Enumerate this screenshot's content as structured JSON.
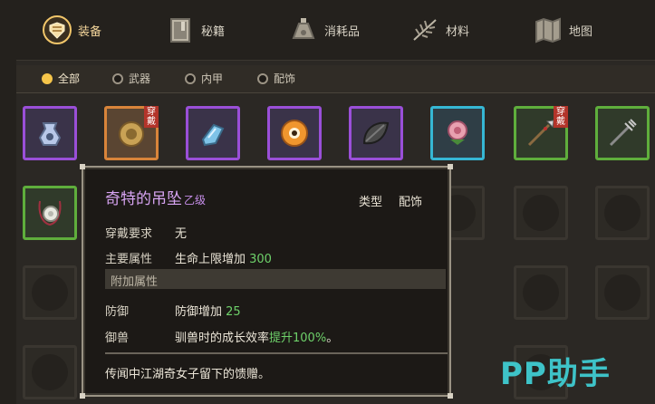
{
  "tabs": [
    {
      "label": "装备",
      "icon": "armor-icon",
      "active": true
    },
    {
      "label": "秘籍",
      "icon": "book-icon",
      "active": false
    },
    {
      "label": "消耗品",
      "icon": "potion-icon",
      "active": false
    },
    {
      "label": "材料",
      "icon": "herb-icon",
      "active": false
    },
    {
      "label": "地图",
      "icon": "map-icon",
      "active": false
    }
  ],
  "filters": [
    {
      "label": "全部",
      "selected": true
    },
    {
      "label": "武器",
      "selected": false
    },
    {
      "label": "内甲",
      "selected": false
    },
    {
      "label": "配饰",
      "selected": false
    }
  ],
  "inventory": [
    {
      "item": "pouch-icon",
      "rarity": "purple",
      "equipped": false
    },
    {
      "item": "shield-icon",
      "rarity": "orange",
      "equipped": true
    },
    {
      "item": "boots-icon",
      "rarity": "purple",
      "equipped": false
    },
    {
      "item": "eye-icon",
      "rarity": "purple",
      "equipped": false
    },
    {
      "item": "leaf-icon",
      "rarity": "purple",
      "equipped": false
    },
    {
      "item": "flower-icon",
      "rarity": "cyan",
      "equipped": false
    },
    {
      "item": "spear-icon",
      "rarity": "green",
      "equipped": true
    },
    {
      "item": "trident-icon",
      "rarity": "green",
      "equipped": false
    },
    {
      "item": "pendant-icon",
      "rarity": "green",
      "equipped": false
    }
  ],
  "equipped_tag": "穿戴",
  "tooltip": {
    "name": "奇特的吊坠",
    "grade": "乙级",
    "type_label": "类型",
    "type_value": "配饰",
    "requirement_label": "穿戴要求",
    "requirement_value": "无",
    "main_attr_label": "主要属性",
    "main_attr_text": "生命上限增加 ",
    "main_attr_num": "300",
    "extra_section": "附加属性",
    "defense_label": "防御",
    "defense_text": "防御增加 ",
    "defense_num": "25",
    "tame_label": "御兽",
    "tame_text": "驯兽时的成长效率",
    "tame_num": "提升100%",
    "tame_end": "。",
    "description": "传闻中江湖奇女子留下的馈赠。"
  },
  "watermark": "PP助手",
  "colors": {
    "accent": "#f5c54a",
    "purple_rarity": "#9a4fd8",
    "orange_rarity": "#d8843a",
    "cyan_rarity": "#36b7d4",
    "green_rarity": "#5fae3c",
    "value_green": "#6ed16a",
    "name_purple": "#d7a4f2"
  }
}
